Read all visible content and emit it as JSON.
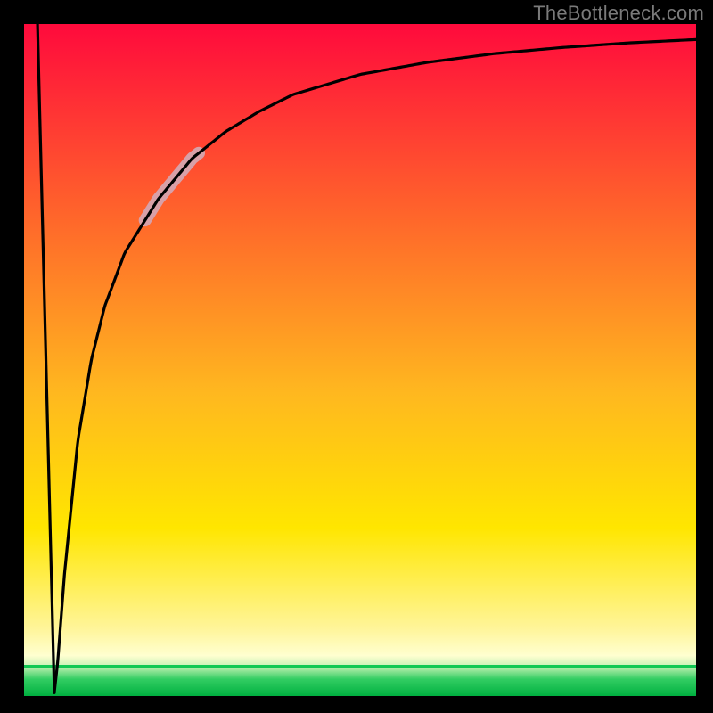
{
  "attribution": "TheBottleneck.com",
  "colors": {
    "black": "#000000",
    "curve": "#000000",
    "highlight": "#d8a0a8",
    "top_gradient": "#ff0a3c",
    "mid_orange": "#ff8a1f",
    "mid_yellow": "#ffe600",
    "pale_yellow": "#ffffc0",
    "green_line": "#10c853",
    "green_band_top": "#7ee28a",
    "green_bottom": "#00b040"
  },
  "chart_data": {
    "type": "line",
    "title": "",
    "xlabel": "",
    "ylabel": "",
    "xlim": [
      0,
      100
    ],
    "ylim": [
      0,
      100
    ],
    "series": [
      {
        "name": "left-edge",
        "x": [
          2,
          4.5
        ],
        "values": [
          100,
          0.5
        ]
      },
      {
        "name": "main-curve",
        "x": [
          4.5,
          5,
          6,
          8,
          10,
          12,
          15,
          20,
          25,
          30,
          35,
          40,
          50,
          60,
          70,
          80,
          90,
          100
        ],
        "values": [
          0.5,
          5,
          18,
          38,
          50,
          58,
          66,
          74,
          80,
          84,
          87,
          89.5,
          92.5,
          94.3,
          95.6,
          96.5,
          97.2,
          97.7
        ]
      }
    ],
    "annotations": [
      {
        "name": "highlight-segment",
        "x_range": [
          18,
          26
        ],
        "on_series": "main-curve"
      }
    ]
  }
}
